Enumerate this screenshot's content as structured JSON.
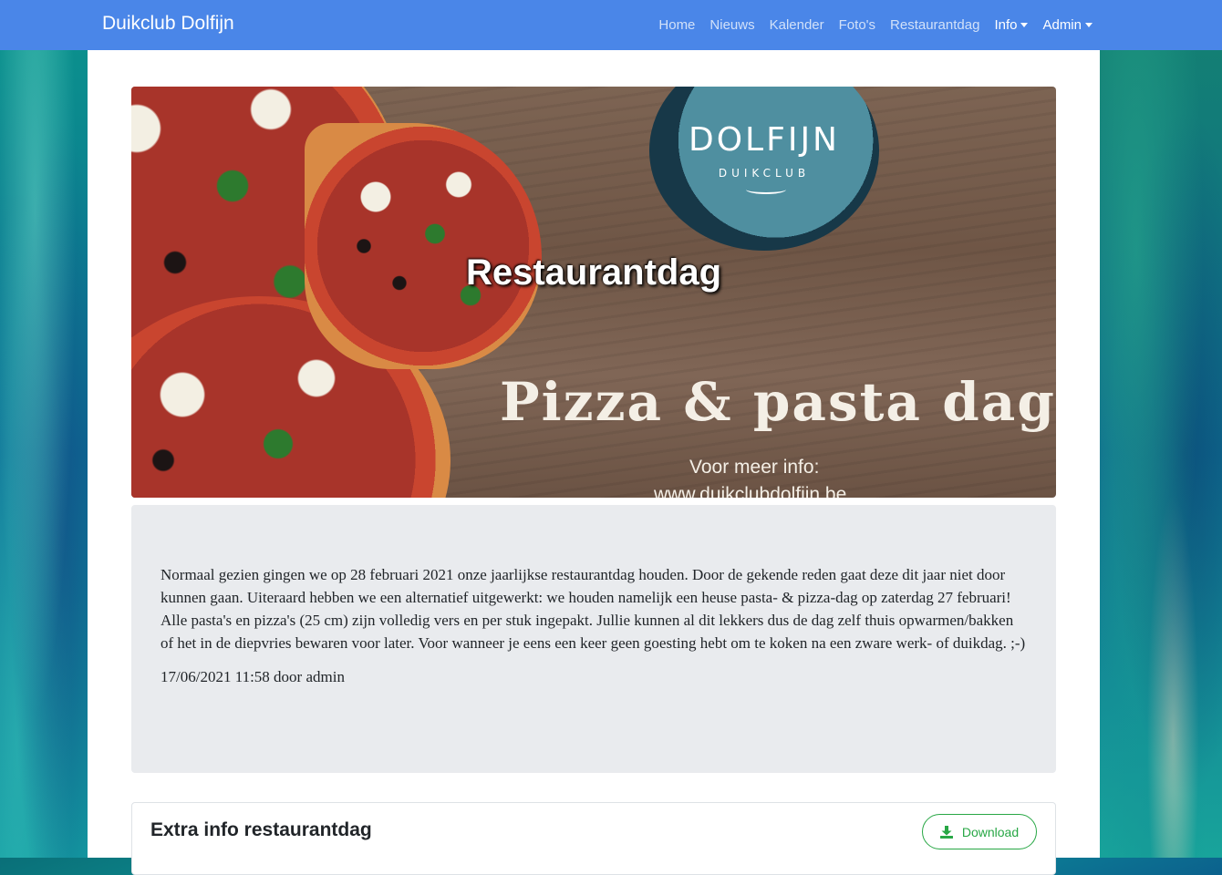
{
  "navbar": {
    "brand": "Duikclub Dolfijn",
    "links": [
      {
        "label": "Home"
      },
      {
        "label": "Nieuws"
      },
      {
        "label": "Kalender"
      },
      {
        "label": "Foto's"
      },
      {
        "label": "Restaurantdag"
      },
      {
        "label": "Info"
      },
      {
        "label": "Admin"
      }
    ],
    "color": "#4a86e8"
  },
  "hero": {
    "title": "Restaurantdag",
    "logo_main": "DOLFIJN",
    "logo_sub": "DUIKCLUB",
    "subtitle": "Pizza & pasta dag",
    "info": "Voor meer info:",
    "url": "www.duikclubdolfijn.be"
  },
  "article": {
    "body": "Normaal gezien gingen we op 28 februari 2021 onze jaarlijkse restaurantdag houden. Door de gekende reden gaat deze dit jaar niet door kunnen gaan. Uiteraard hebben we een alternatief uitgewerkt: we houden namelijk een heuse pasta- & pizza-dag op zaterdag 27 februari! Alle pasta's en pizza's (25 cm) zijn volledig vers en per stuk ingepakt. Jullie kunnen al dit lekkers dus de dag zelf thuis opwarmen/bakken of het in de diepvries bewaren voor later. Voor wanneer je eens een keer geen goesting hebt om te koken na een zware werk- of duikdag. ;-)",
    "meta": "17/06/2021 11:58 door admin"
  },
  "extra_card": {
    "title": "Extra info restaurantdag",
    "download_label": "Download",
    "download_icon": "download-icon",
    "accent": "#28a745"
  }
}
